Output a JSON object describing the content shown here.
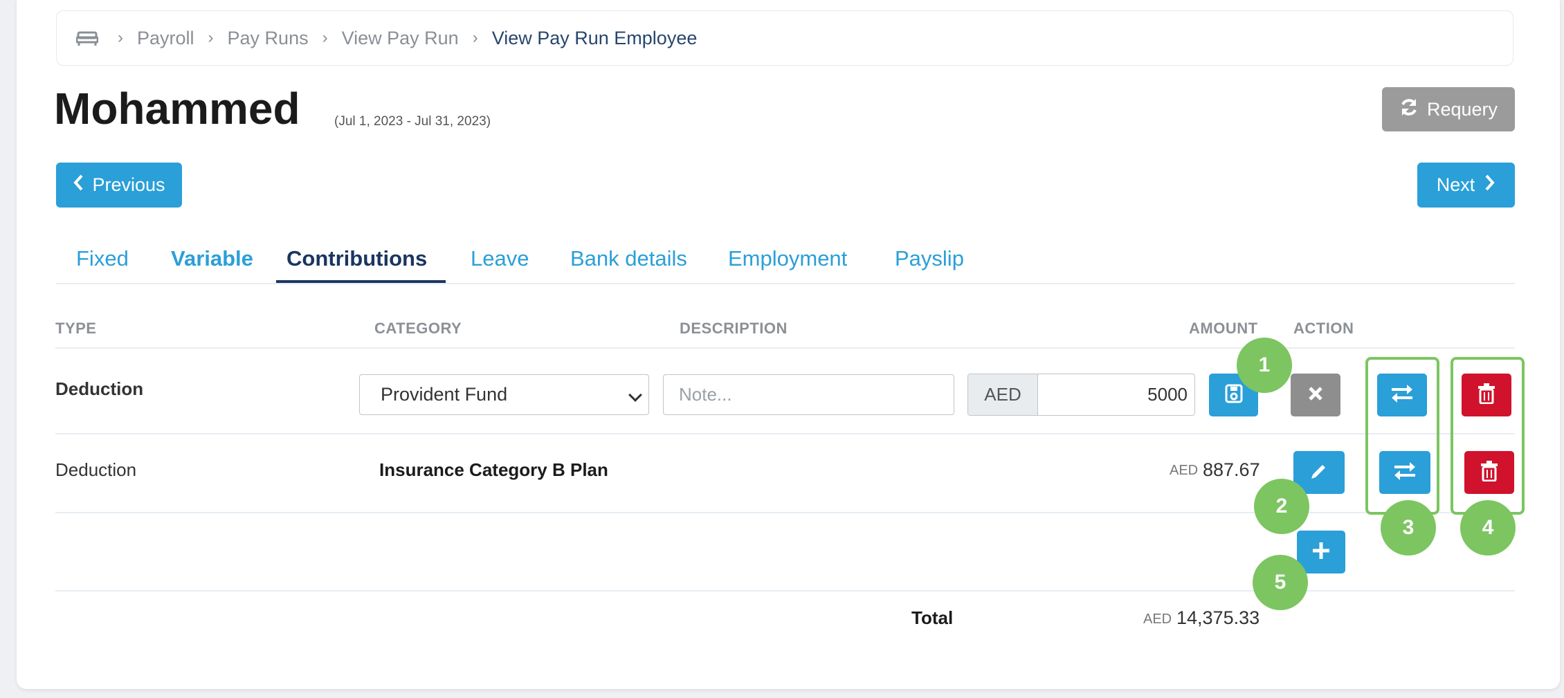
{
  "breadcrumb": {
    "items": [
      "Payroll",
      "Pay Runs",
      "View Pay Run"
    ],
    "current": "View Pay Run Employee"
  },
  "employee": {
    "name": "Mohammed",
    "period": "(Jul 1, 2023 - Jul 31, 2023)"
  },
  "buttons": {
    "requery": "Requery",
    "previous": "Previous",
    "next": "Next"
  },
  "tabs": [
    "Fixed",
    "Variable",
    "Contributions",
    "Leave",
    "Bank details",
    "Employment",
    "Payslip"
  ],
  "active_tab": "Contributions",
  "table": {
    "headers": {
      "type": "TYPE",
      "category": "CATEGORY",
      "description": "DESCRIPTION",
      "amount": "AMOUNT",
      "action": "ACTION"
    },
    "edit_row": {
      "type": "Deduction",
      "category_selected": "Provident Fund",
      "description_placeholder": "Note...",
      "currency": "AED",
      "amount": "5000"
    },
    "rows": [
      {
        "type": "Deduction",
        "category": "Insurance Category B Plan",
        "currency": "AED",
        "amount": "887.67"
      }
    ],
    "total": {
      "label": "Total",
      "currency": "AED",
      "amount": "14,375.33"
    }
  },
  "callouts": [
    "1",
    "2",
    "3",
    "4",
    "5"
  ],
  "colors": {
    "primary": "#2a9fd8",
    "danger": "#d0122c",
    "muted": "#9b9b9b",
    "callout": "#7cc561",
    "active_tab": "#1a3560"
  }
}
